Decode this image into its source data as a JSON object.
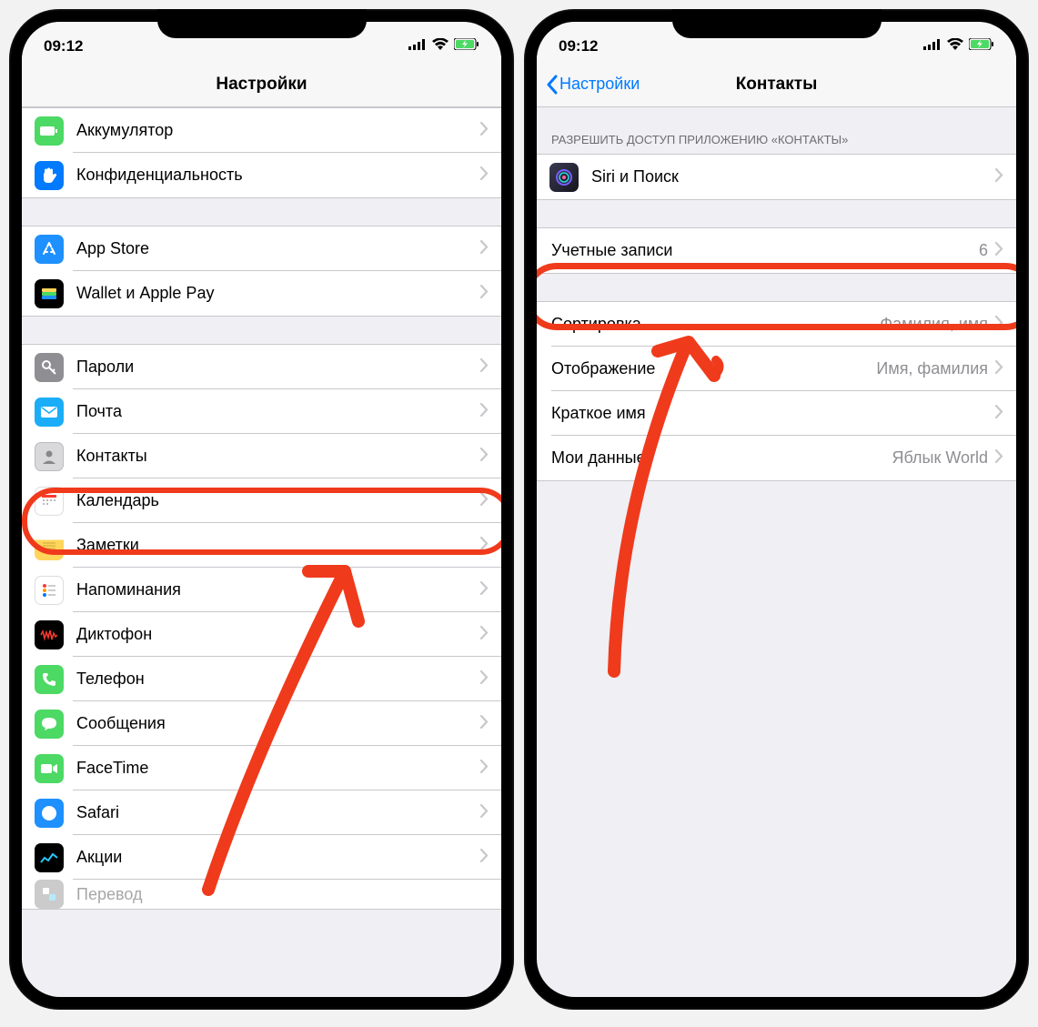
{
  "status": {
    "time": "09:12"
  },
  "phone1": {
    "title": "Настройки",
    "groups": [
      {
        "rows": [
          {
            "id": "battery",
            "label": "Аккумулятор",
            "icon": "battery-icon",
            "bg": "#4cd964"
          },
          {
            "id": "privacy",
            "label": "Конфиденциальность",
            "icon": "hand-icon",
            "bg": "#007aff"
          }
        ]
      },
      {
        "rows": [
          {
            "id": "appstore",
            "label": "App Store",
            "icon": "appstore-icon",
            "bg": "#1e90ff"
          },
          {
            "id": "wallet",
            "label": "Wallet и Apple Pay",
            "icon": "wallet-icon",
            "bg": "#000000"
          }
        ]
      },
      {
        "rows": [
          {
            "id": "passwords",
            "label": "Пароли",
            "icon": "key-icon",
            "bg": "#8e8e93"
          },
          {
            "id": "mail",
            "label": "Почта",
            "icon": "mail-icon",
            "bg": "#1badf8"
          },
          {
            "id": "contacts",
            "label": "Контакты",
            "icon": "contacts-icon",
            "bg": "#d9d9db"
          },
          {
            "id": "calendar",
            "label": "Календарь",
            "icon": "calendar-icon",
            "bg": "#ffffff"
          },
          {
            "id": "notes",
            "label": "Заметки",
            "icon": "notes-icon",
            "bg": "#ffd55a"
          },
          {
            "id": "reminders",
            "label": "Напоминания",
            "icon": "reminders-icon",
            "bg": "#ffffff"
          },
          {
            "id": "voicememo",
            "label": "Диктофон",
            "icon": "voicememo-icon",
            "bg": "#000000"
          },
          {
            "id": "phone",
            "label": "Телефон",
            "icon": "phone-icon",
            "bg": "#4cd964"
          },
          {
            "id": "messages",
            "label": "Сообщения",
            "icon": "messages-icon",
            "bg": "#4cd964"
          },
          {
            "id": "facetime",
            "label": "FaceTime",
            "icon": "facetime-icon",
            "bg": "#4cd964"
          },
          {
            "id": "safari",
            "label": "Safari",
            "icon": "safari-icon",
            "bg": "#1e90ff"
          },
          {
            "id": "stocks",
            "label": "Акции",
            "icon": "stocks-icon",
            "bg": "#000000"
          },
          {
            "id": "translate",
            "label": "Перевод",
            "icon": "translate-icon",
            "bg": "#6c6c6c"
          }
        ]
      }
    ]
  },
  "phone2": {
    "back": "Настройки",
    "title": "Контакты",
    "section_header": "Разрешить доступ приложению «Контакты»",
    "groups": [
      {
        "header_key": "section_header",
        "rows": [
          {
            "id": "siri",
            "label": "Siri и Поиск",
            "icon": "siri-icon",
            "bg": "linear-gradient(135deg,#2b2b3b,#151520)"
          }
        ]
      },
      {
        "rows": [
          {
            "id": "accounts",
            "label": "Учетные записи",
            "value": "6"
          }
        ]
      },
      {
        "rows": [
          {
            "id": "sort",
            "label": "Сортировка",
            "value": "Фамилия, имя"
          },
          {
            "id": "display",
            "label": "Отображение",
            "value": "Имя, фамилия"
          },
          {
            "id": "shortname",
            "label": "Краткое имя"
          },
          {
            "id": "mydata",
            "label": "Мои данные",
            "value": "Яблык World"
          }
        ]
      }
    ]
  }
}
